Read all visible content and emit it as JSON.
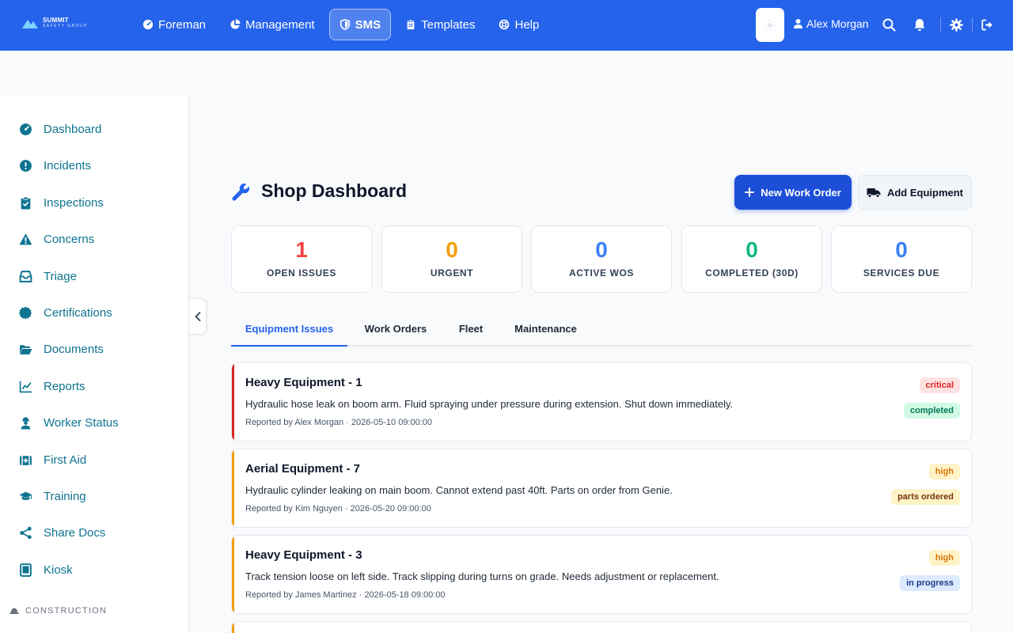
{
  "brand": {
    "name": "SUMMIT",
    "sub": "SAFETY GROUP"
  },
  "nav": [
    {
      "label": "Foreman",
      "icon": "gauge-icon"
    },
    {
      "label": "Management",
      "icon": "pie-chart-icon"
    },
    {
      "label": "SMS",
      "icon": "shield-icon",
      "active": true
    },
    {
      "label": "Templates",
      "icon": "clipboard-icon"
    },
    {
      "label": "Help",
      "icon": "lifebuoy-icon"
    }
  ],
  "user": {
    "name": "Alex Morgan"
  },
  "sidebar": {
    "items": [
      {
        "label": "Dashboard",
        "icon": "gauge-icon"
      },
      {
        "label": "Incidents",
        "icon": "alert-circle-icon"
      },
      {
        "label": "Inspections",
        "icon": "clipboard-check-icon"
      },
      {
        "label": "Concerns",
        "icon": "warning-triangle-icon"
      },
      {
        "label": "Triage",
        "icon": "inbox-icon"
      },
      {
        "label": "Certifications",
        "icon": "certificate-icon"
      },
      {
        "label": "Documents",
        "icon": "folder-open-icon"
      },
      {
        "label": "Reports",
        "icon": "line-chart-icon"
      },
      {
        "label": "Worker Status",
        "icon": "worker-icon"
      },
      {
        "label": "First Aid",
        "icon": "medkit-icon"
      },
      {
        "label": "Training",
        "icon": "graduation-cap-icon"
      },
      {
        "label": "Share Docs",
        "icon": "share-icon"
      },
      {
        "label": "Kiosk",
        "icon": "tablet-icon"
      }
    ],
    "section": "CONSTRUCTION"
  },
  "page": {
    "title": "Shop Dashboard",
    "new_wo_label": "New Work Order",
    "add_equipment_label": "Add Equipment"
  },
  "stats": [
    {
      "value": "1",
      "label": "OPEN ISSUES",
      "color": "#ef4444"
    },
    {
      "value": "0",
      "label": "URGENT",
      "color": "#f59e0b"
    },
    {
      "value": "0",
      "label": "ACTIVE WOS",
      "color": "#3b82f6"
    },
    {
      "value": "0",
      "label": "COMPLETED (30D)",
      "color": "#10b981"
    },
    {
      "value": "0",
      "label": "SERVICES DUE",
      "color": "#3b82f6"
    }
  ],
  "tabs": [
    {
      "label": "Equipment Issues",
      "active": true
    },
    {
      "label": "Work Orders"
    },
    {
      "label": "Fleet"
    },
    {
      "label": "Maintenance"
    }
  ],
  "issues": [
    {
      "title": "Heavy Equipment - 1",
      "description": "Hydraulic hose leak on boom arm. Fluid spraying under pressure during extension. Shut down immediately.",
      "meta": "Reported by Alex Morgan · 2026-05-10 09:00:00",
      "severity": "critical",
      "status": "completed",
      "accent": "#dc2626"
    },
    {
      "title": "Aerial Equipment - 7",
      "description": "Hydraulic cylinder leaking on main boom. Cannot extend past 40ft. Parts on order from Genie.",
      "meta": "Reported by Kim Nguyen · 2026-05-20 09:00:00",
      "severity": "high",
      "status": "parts ordered",
      "accent": "#f59e0b"
    },
    {
      "title": "Heavy Equipment - 3",
      "description": "Track tension loose on left side. Track slipping during turns on grade. Needs adjustment or replacement.",
      "meta": "Reported by James Martinez · 2026-05-18 09:00:00",
      "severity": "high",
      "status": "in progress",
      "accent": "#f59e0b"
    }
  ]
}
